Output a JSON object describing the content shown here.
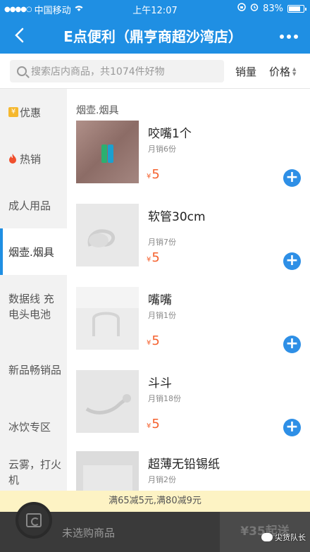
{
  "status_bar": {
    "carrier": "中国移动",
    "time": "上午12:07",
    "battery": "83%",
    "battery_level": 0.83
  },
  "nav": {
    "back_icon": "chevron-left-icon",
    "title": "E点便利（鼎亨商超沙湾店）",
    "more_icon": "more-dots-icon"
  },
  "search": {
    "placeholder": "搜索店内商品，共1074件好物",
    "sort_sales": "销量",
    "sort_price": "价格"
  },
  "sidebar": {
    "items": [
      {
        "label": "优惠",
        "icon": "discount-icon"
      },
      {
        "label": "热销",
        "icon": "fire-icon"
      },
      {
        "label": "成人用品"
      },
      {
        "label": "烟壶.烟具",
        "active": true
      },
      {
        "label": "数据线 充电头电池"
      },
      {
        "label": "新品畅销品"
      },
      {
        "label": "冰饮专区"
      },
      {
        "label": "云雾，打火机"
      }
    ]
  },
  "category": {
    "title": "烟壶.烟具"
  },
  "products": [
    {
      "name": "咬嘴1个",
      "sales": "月销6份",
      "currency": "¥",
      "price": "5"
    },
    {
      "name": "软管30cm",
      "sales": "月销7份",
      "currency": "¥",
      "price": "5"
    },
    {
      "name": "嘴嘴",
      "sales": "月销1份",
      "currency": "¥",
      "price": "5"
    },
    {
      "name": "斗斗",
      "sales": "月销18份",
      "currency": "¥",
      "price": "5"
    },
    {
      "name": "超薄无铅锡纸",
      "sales": "月销2份"
    }
  ],
  "promo": {
    "text": "满65减5元,满80减9元"
  },
  "cart": {
    "empty_text": "未选购商品",
    "min_order": "¥35起送"
  },
  "watermark": {
    "text": "尖货队长"
  },
  "colors": {
    "primary": "#1f8fe3",
    "price": "#f5612e",
    "promo_bg": "#fdf3c4"
  }
}
